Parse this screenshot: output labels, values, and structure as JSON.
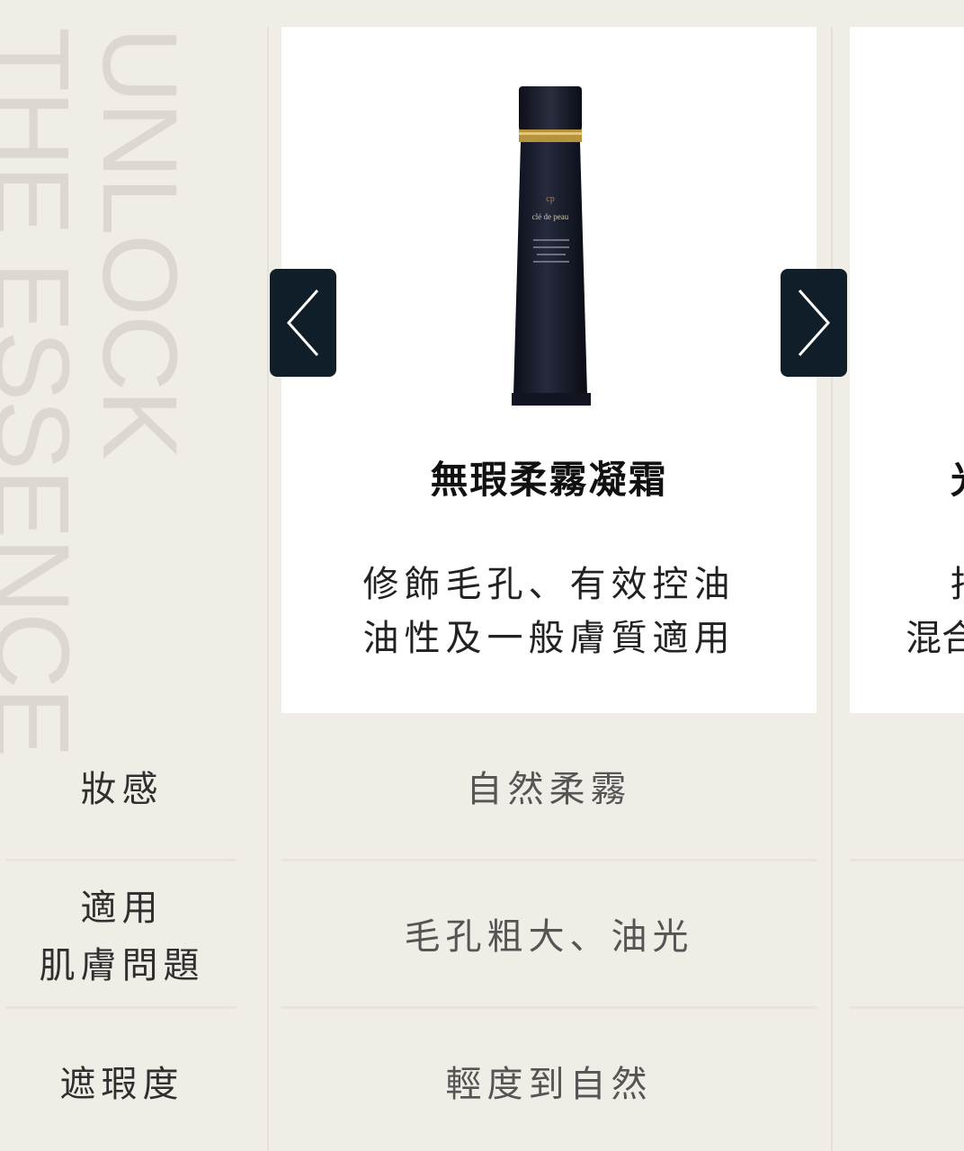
{
  "watermark": {
    "line1": "UNLOCK",
    "line2": "THE ESSENCE"
  },
  "carousel": {
    "prev_icon": "chevron-left-icon",
    "next_icon": "chevron-right-icon",
    "current": {
      "title": "無瑕柔霧凝霜",
      "desc_line1": "修飾毛孔、有效控油",
      "desc_line2": "油性及一般膚質適用",
      "image": "product-tube-image",
      "brand": "clé de peau BEAUTÉ"
    },
    "next_peek": {
      "title": "光",
      "desc_line1": "抒",
      "desc_line2": "混合"
    }
  },
  "table": {
    "rows": [
      {
        "label": "妝感",
        "value": "自然柔霧"
      },
      {
        "label_line1": "適用",
        "label_line2": "肌膚問題",
        "value": "毛孔粗大、油光"
      },
      {
        "label": "遮瑕度",
        "value": "輕度到自然"
      }
    ]
  },
  "colors": {
    "background": "#f0ede7",
    "card": "#ffffff",
    "arrow_bg": "#0f1e28",
    "watermark": "#dcd8d1"
  }
}
